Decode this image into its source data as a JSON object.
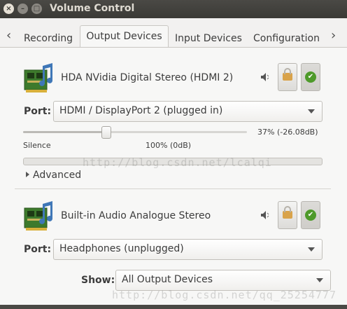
{
  "window": {
    "title": "Volume Control",
    "close_glyph": "×",
    "min_glyph": "–",
    "max_glyph": "□"
  },
  "tabs": {
    "prev_arrow": "‹",
    "next_arrow": "›",
    "items": [
      {
        "label": "Recording"
      },
      {
        "label": "Output Devices"
      },
      {
        "label": "Input Devices"
      },
      {
        "label": "Configuration"
      }
    ]
  },
  "devices": [
    {
      "name": "HDA NVidia Digital Stereo (HDMI 2)",
      "port_label": "Port:",
      "port_value": "HDMI / DisplayPort 2 (plugged in)",
      "volume_readout": "37% (-26.08dB)",
      "volume_fraction": 0.37,
      "silence_label": "Silence",
      "reference_label": "100% (0dB)",
      "advanced_label": "Advanced"
    },
    {
      "name": "Built-in Audio Analogue Stereo",
      "port_label": "Port:",
      "port_value": "Headphones (unplugged)"
    }
  ],
  "show": {
    "label": "Show:",
    "value": "All Output Devices"
  },
  "icons": {
    "speaker": "speaker-icon",
    "lock": "lock-icon",
    "check": "check-icon"
  },
  "watermarks": [
    "http://blog.csdn.net/lcalqi",
    "http://blog.csdn.net/qq_25254777"
  ]
}
